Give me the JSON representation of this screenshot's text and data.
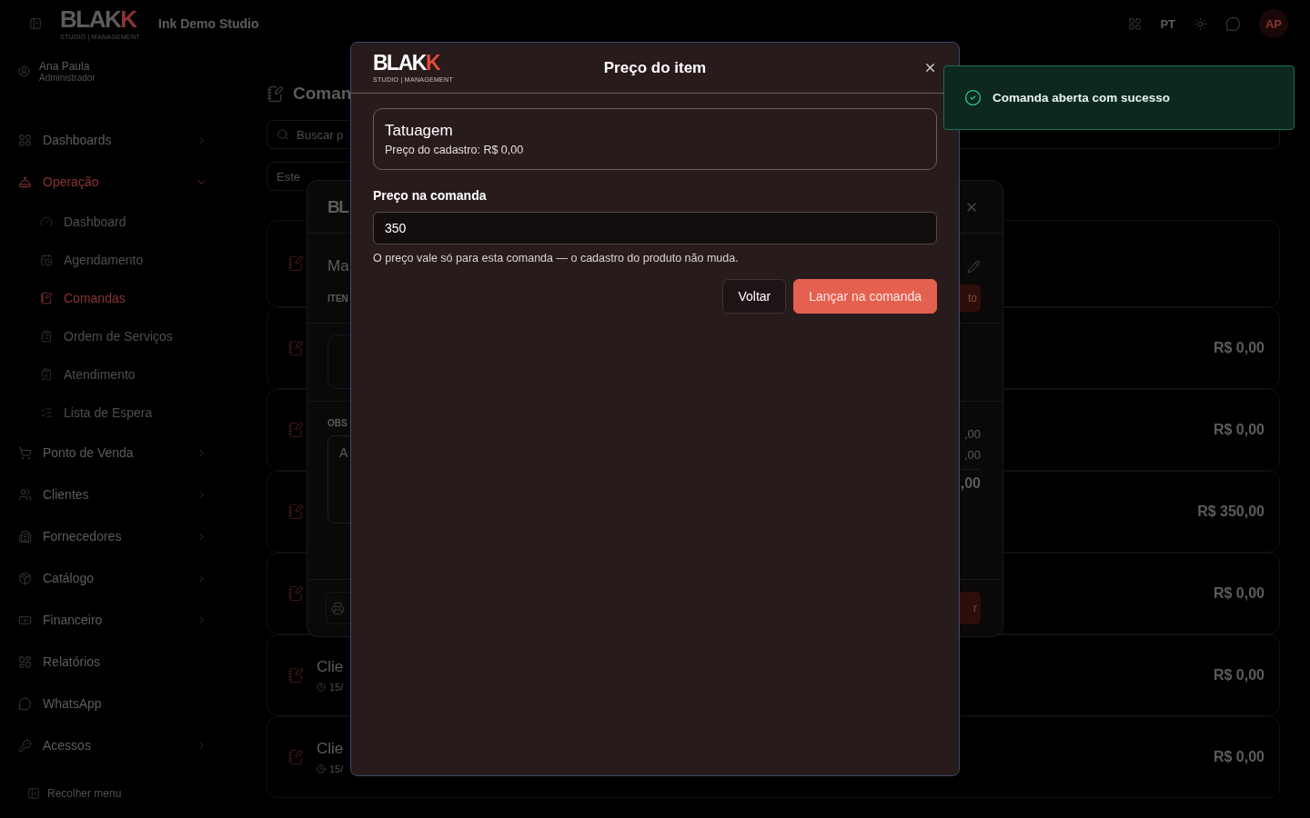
{
  "topbar": {
    "logo": {
      "main": "BLAK",
      "accent": "K",
      "tagline": "STUDIO | MANAGEMENT"
    },
    "studio": "Ink Demo Studio",
    "language": "PT",
    "avatar": "AP"
  },
  "user": {
    "name": "Ana Paula",
    "role": "Administrador"
  },
  "sidebar": {
    "items": [
      {
        "label": "Dashboards",
        "kind": "group",
        "expanded": false,
        "selected": false
      },
      {
        "label": "Operação",
        "kind": "group",
        "expanded": true,
        "selected": true,
        "children": [
          {
            "label": "Dashboard",
            "selected": false
          },
          {
            "label": "Agendamento",
            "selected": false
          },
          {
            "label": "Comandas",
            "selected": true
          },
          {
            "label": "Ordem de Serviços",
            "selected": false
          },
          {
            "label": "Atendimento",
            "selected": false
          },
          {
            "label": "Lista de Espera",
            "selected": false
          }
        ]
      },
      {
        "label": "Ponto de Venda",
        "kind": "group",
        "expanded": false,
        "selected": false
      },
      {
        "label": "Clientes",
        "kind": "group",
        "expanded": false,
        "selected": false
      },
      {
        "label": "Fornecedores",
        "kind": "group",
        "expanded": false,
        "selected": false
      },
      {
        "label": "Catálogo",
        "kind": "group",
        "expanded": false,
        "selected": false
      },
      {
        "label": "Financeiro",
        "kind": "group",
        "expanded": false,
        "selected": false
      },
      {
        "label": "Relatórios",
        "kind": "link",
        "selected": false
      },
      {
        "label": "WhatsApp",
        "kind": "link",
        "selected": false
      },
      {
        "label": "Acessos",
        "kind": "group",
        "expanded": false,
        "selected": false
      }
    ],
    "collapse": "Recolher menu"
  },
  "page": {
    "title": "Coman",
    "search": {
      "placeholder": "Buscar p"
    },
    "filter": "Este",
    "cards": [
      {
        "kind": "tall"
      },
      {
        "kind": "regular",
        "amount": "R$ 0,00"
      },
      {
        "kind": "regular",
        "amount": "R$ 0,00"
      },
      {
        "kind": "regular",
        "amount": "R$ 350,00"
      },
      {
        "kind": "regular",
        "amount": "R$ 0,00"
      },
      {
        "kind": "regular",
        "name": "Clie",
        "meta": "15/",
        "amount": "R$ 0,00"
      },
      {
        "kind": "regular",
        "name": "Clie",
        "meta": "15/",
        "amount": "R$ 0,00"
      }
    ]
  },
  "back_modal": {
    "logo": "BL",
    "title": "Ma",
    "section_1": "ITEN",
    "section_2": "OBS",
    "notes_value": "A",
    "action_label": "to",
    "amounts": [
      ",00",
      ",00"
    ],
    "total": ",00",
    "confirm_label": "r"
  },
  "modal": {
    "logo": {
      "main": "BLAK",
      "accent": "K",
      "tagline": "STUDIO | MANAGEMENT"
    },
    "title": "Preço do item",
    "item": {
      "name": "Tatuagem",
      "detail": "Preço do cadastro: R$ 0,00"
    },
    "price_label": "Preço na comanda",
    "price_value": "350",
    "hint": "O preço vale só para esta comanda — o cadastro do produto não muda.",
    "buttons": [
      {
        "label": "Voltar",
        "kind": "secondary"
      },
      {
        "label": "Lançar na comanda",
        "kind": "primary"
      }
    ]
  },
  "toast": {
    "message": "Comanda aberta com sucesso"
  }
}
